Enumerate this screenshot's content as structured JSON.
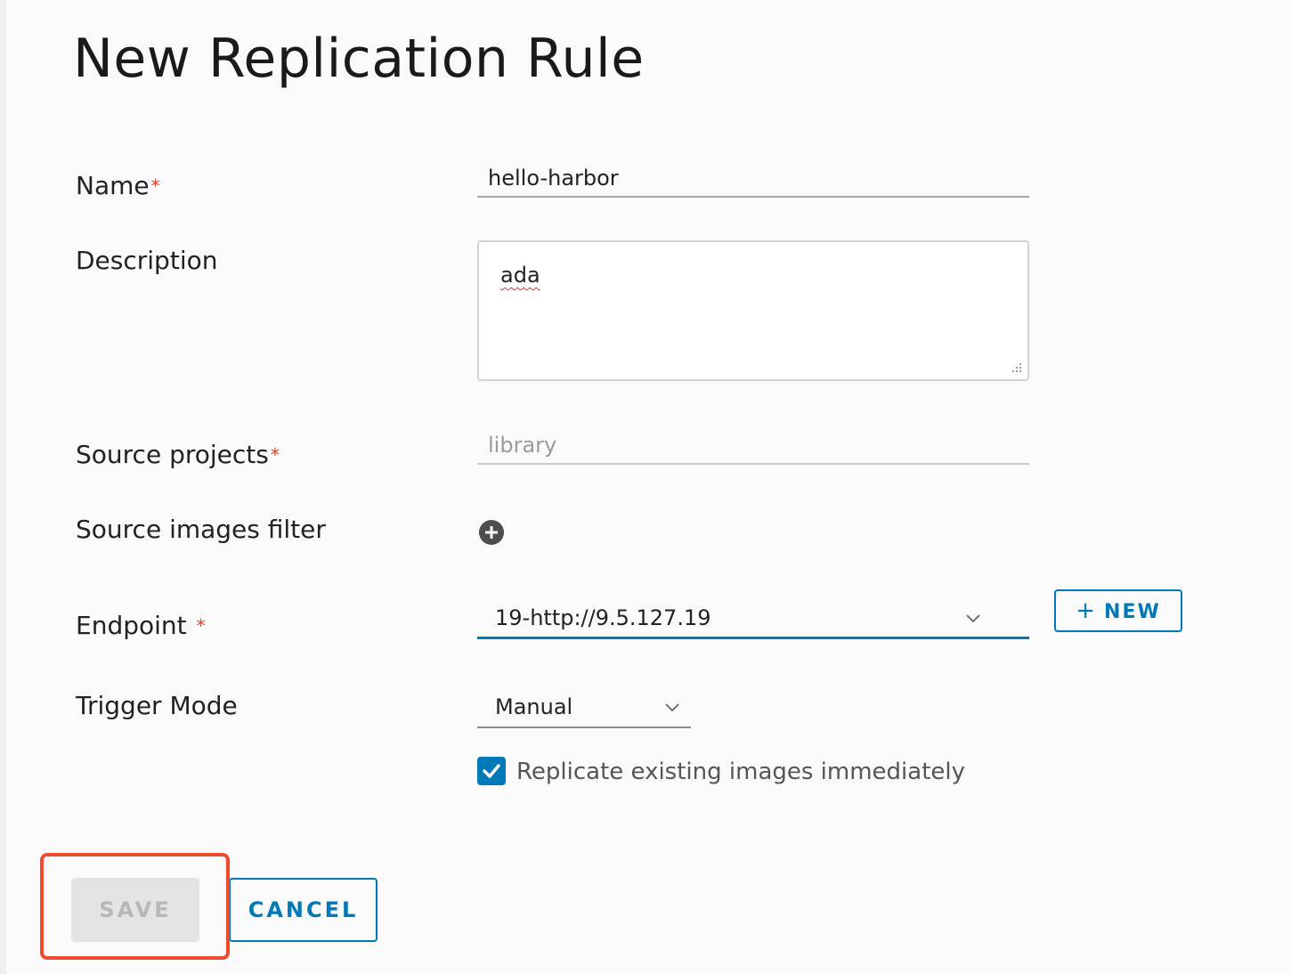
{
  "page": {
    "title": "New Replication Rule"
  },
  "form": {
    "name": {
      "label": "Name",
      "required_mark": "*",
      "value": "hello-harbor"
    },
    "description": {
      "label": "Description",
      "value": "ada"
    },
    "source_projects": {
      "label": "Source projects",
      "required_mark": "*",
      "value": "library",
      "disabled": true
    },
    "source_images_filter": {
      "label": "Source images filter",
      "add_icon": "plus-circle-icon"
    },
    "endpoint": {
      "label": "Endpoint",
      "required_mark": "*",
      "selected": "19-http://9.5.127.19",
      "new_button_label": "NEW",
      "new_button_icon": "+"
    },
    "trigger_mode": {
      "label": "Trigger Mode",
      "selected": "Manual"
    },
    "replicate_existing": {
      "label": "Replicate existing images immediately",
      "checked": true
    }
  },
  "actions": {
    "save_label": "SAVE",
    "save_disabled": true,
    "cancel_label": "CANCEL"
  },
  "colors": {
    "accent": "#0079b8",
    "required": "#e23d28",
    "highlight": "#f0492d"
  }
}
